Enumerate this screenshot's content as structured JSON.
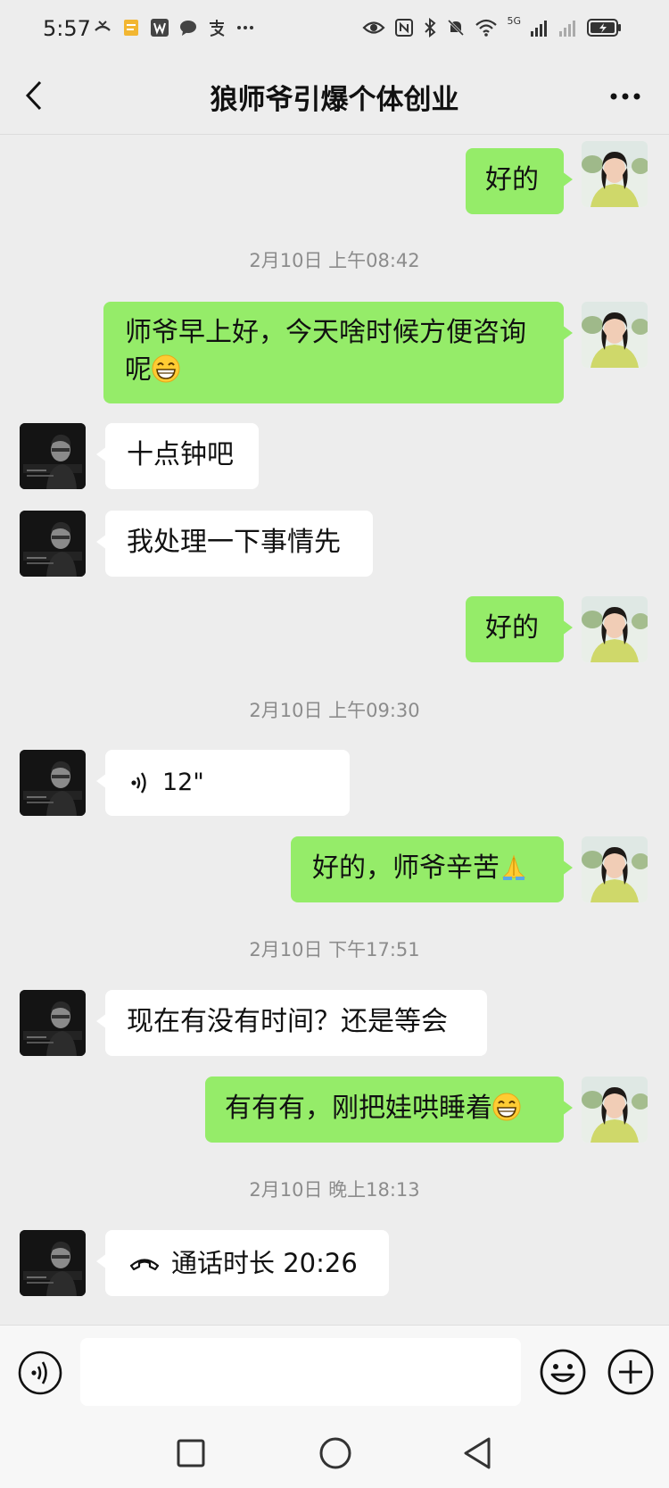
{
  "status_bar": {
    "time": "5:57",
    "signal_label": "5G",
    "icons_left": [
      "missed-call-icon",
      "notes-icon",
      "w-app-icon",
      "chat-bubble-icon",
      "alipay-icon",
      "more-dots-icon"
    ],
    "icons_right": [
      "eye-icon",
      "nfc-icon",
      "bluetooth-icon",
      "mute-icon",
      "wifi-icon",
      "signal-icon",
      "signal-empty-icon",
      "battery-charging-icon"
    ]
  },
  "header": {
    "title": "狼师爷引爆个体创业",
    "back_icon": "back-chevron-icon",
    "more_icon": "more-icon"
  },
  "messages": [
    {
      "type": "text",
      "dir": "out",
      "text": "好的"
    },
    {
      "type": "time",
      "text": "2月10日 上午08:42"
    },
    {
      "type": "text",
      "dir": "out",
      "text": "师爷早上好，今天啥时候方便咨询呢",
      "emoji": "grin-emoji"
    },
    {
      "type": "text",
      "dir": "in",
      "text": "十点钟吧"
    },
    {
      "type": "text",
      "dir": "in",
      "text": "我处理一下事情先"
    },
    {
      "type": "text",
      "dir": "out",
      "text": "好的"
    },
    {
      "type": "time",
      "text": "2月10日 上午09:30"
    },
    {
      "type": "voice",
      "dir": "in",
      "text": "12\""
    },
    {
      "type": "text",
      "dir": "out",
      "text": "好的，师爷辛苦",
      "emoji": "pray-emoji"
    },
    {
      "type": "time",
      "text": "2月10日 下午17:51"
    },
    {
      "type": "text",
      "dir": "in",
      "text": "现在有没有时间？还是等会"
    },
    {
      "type": "text",
      "dir": "out",
      "text": "有有有，刚把娃哄睡着",
      "emoji": "grin-emoji"
    },
    {
      "type": "time",
      "text": "2月10日 晚上18:13"
    },
    {
      "type": "call",
      "dir": "in",
      "text": "通话时长 20:26"
    }
  ],
  "input_bar": {
    "value": "",
    "voice_icon": "voice-icon",
    "emoji_icon": "emoji-icon",
    "plus_icon": "plus-icon"
  },
  "nav_bar": {
    "icons": [
      "recents-icon",
      "home-icon",
      "back-icon"
    ]
  },
  "colors": {
    "background": "#ededed",
    "outgoing_bubble": "#95ec69",
    "incoming_bubble": "#ffffff",
    "timestamp": "#8c8c8c"
  }
}
